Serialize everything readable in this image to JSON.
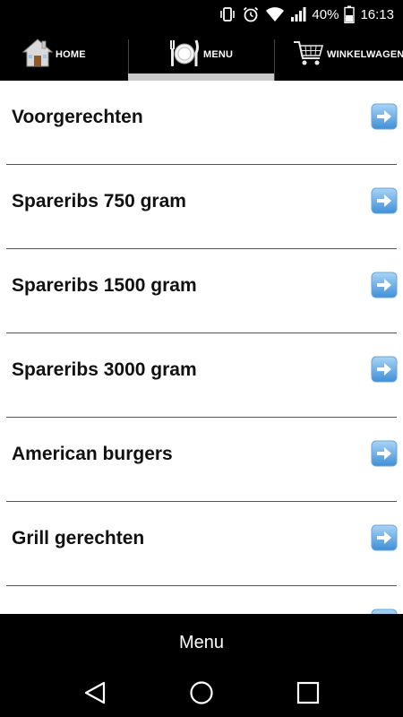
{
  "status_bar": {
    "battery_percent": "40%",
    "time": "16:13",
    "icons": [
      "vibrate-icon",
      "alarm-icon",
      "wifi-icon",
      "signal-icon",
      "battery-icon"
    ]
  },
  "tabs": [
    {
      "label": "HOME",
      "icon": "house-icon",
      "selected": false
    },
    {
      "label": "MENU",
      "icon": "plate-cutlery-icon",
      "selected": true
    },
    {
      "label": "WINKELWAGEN",
      "icon": "shopping-cart-icon",
      "selected": false
    }
  ],
  "menu_items": [
    {
      "label": "Voorgerechten"
    },
    {
      "label": "Spareribs 750 gram"
    },
    {
      "label": "Spareribs 1500 gram"
    },
    {
      "label": "Spareribs 3000 gram"
    },
    {
      "label": "American burgers"
    },
    {
      "label": "Grill gerechten"
    },
    {
      "label": ""
    }
  ],
  "bottom_bar": {
    "title": "Menu"
  },
  "nav": {
    "back": "back-icon",
    "home": "home-circle-icon",
    "recents": "recents-icon"
  },
  "colors": {
    "background": "#ffffff",
    "bars": "#000000",
    "tab_indicator": "#c9c9c9",
    "arrow_button": "#5aa7e3"
  }
}
